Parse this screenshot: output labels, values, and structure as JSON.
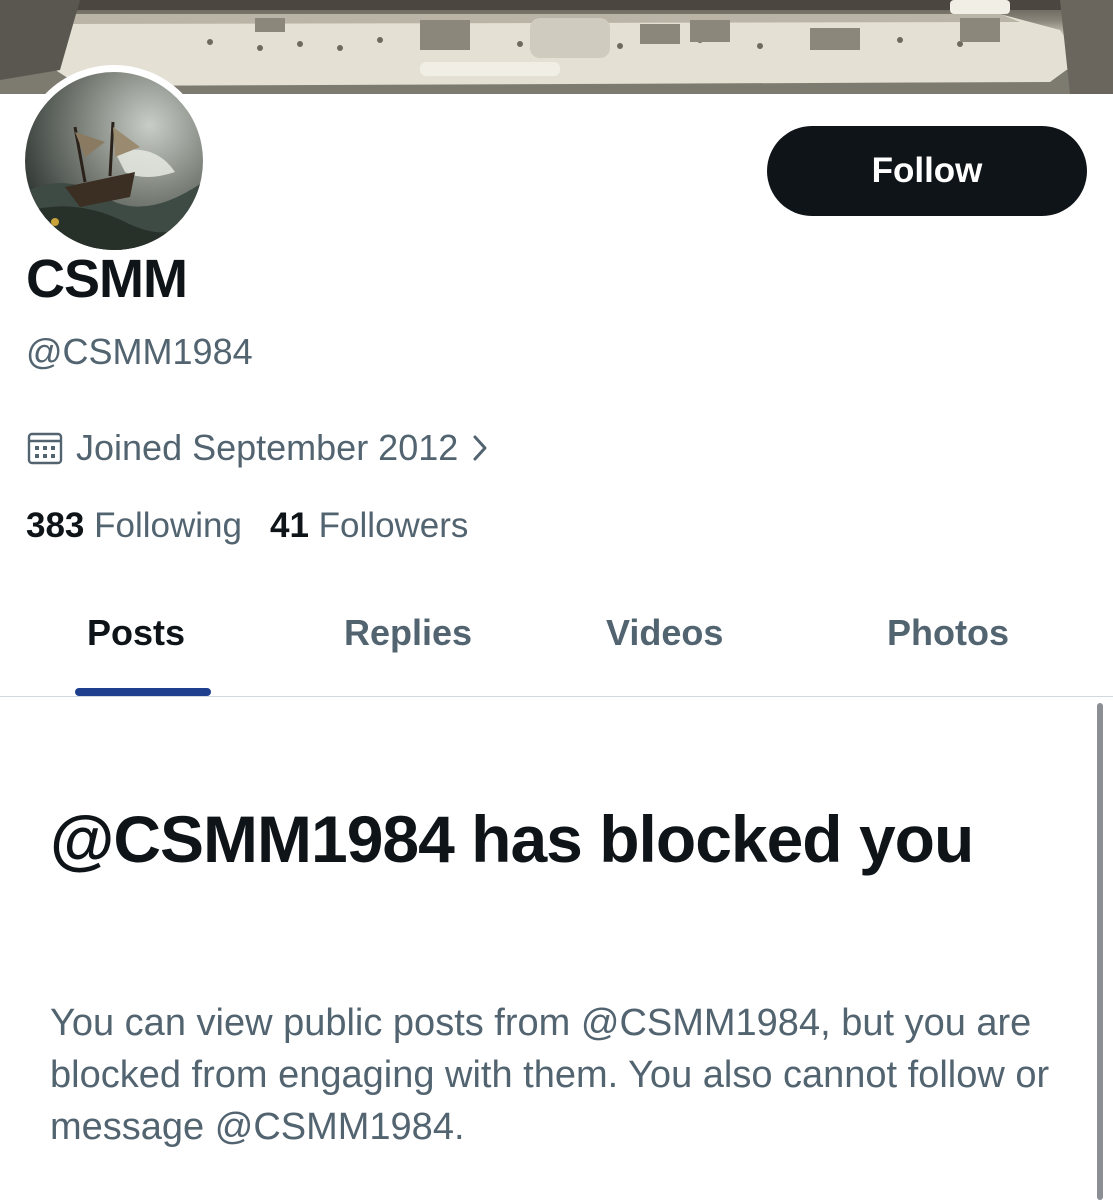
{
  "profile": {
    "display_name": "CSMM",
    "handle": "@CSMM1984",
    "joined": "Joined September 2012",
    "following_count": "383",
    "following_label": "Following",
    "followers_count": "41",
    "followers_label": "Followers"
  },
  "actions": {
    "follow_label": "Follow"
  },
  "tabs": [
    {
      "label": "Posts",
      "active": true
    },
    {
      "label": "Replies",
      "active": false
    },
    {
      "label": "Videos",
      "active": false
    },
    {
      "label": "Photos",
      "active": false
    }
  ],
  "blocked": {
    "title": "@CSMM1984 has blocked you",
    "description": "You can view public posts from @CSMM1984, but you are blocked from engaging with them. You also cannot follow or message @CSMM1984."
  },
  "icons": {
    "joined": "calendar-icon",
    "joined_more": "chevron-right-icon"
  },
  "colors": {
    "text_primary": "#0f1419",
    "text_secondary": "#536471",
    "follow_button_bg": "#0f1419",
    "tab_indicator": "#1d3f8e",
    "divider": "#cfd9de"
  }
}
